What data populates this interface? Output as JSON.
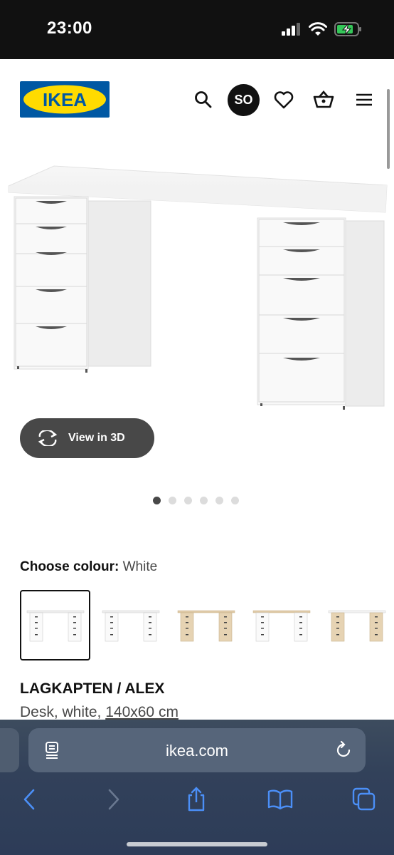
{
  "status_bar": {
    "time": "23:00"
  },
  "header": {
    "logo_text": "IKEA",
    "avatar_initials": "SO",
    "icons": [
      "search-icon",
      "heart-icon",
      "basket-icon",
      "menu-icon"
    ]
  },
  "gallery": {
    "view_3d_label": "View in 3D",
    "dot_count": 6,
    "active_dot": 1
  },
  "colour": {
    "label": "Choose colour:",
    "value": "White",
    "swatches": [
      "white",
      "white",
      "beige",
      "white-beige",
      "beige-white"
    ],
    "selected_index": 0
  },
  "product": {
    "name": "LAGKAPTEN / ALEX",
    "description": "Desk, white, ",
    "size": "140x60 cm"
  },
  "browser": {
    "url": "ikea.com"
  },
  "colors": {
    "ikea_blue": "#0058a3",
    "ikea_yellow": "#ffdb00",
    "button_grey": "#484848"
  }
}
